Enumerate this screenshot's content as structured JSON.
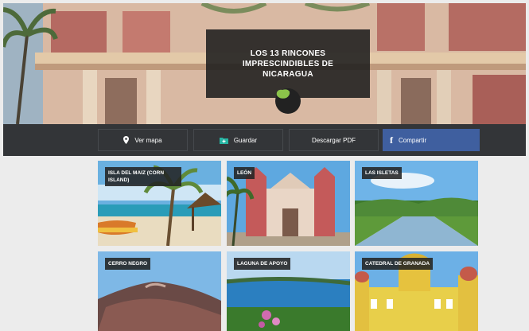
{
  "hero": {
    "title": "LOS 13 RINCONES IMPRESCINDIBLES DE NICARAGUA",
    "badge_icon": "nicaragua-map-icon",
    "accent": "#8bc34a"
  },
  "actions": {
    "map_label": "Ver mapa",
    "map_icon": "location-pin-icon",
    "save_label": "Guardar",
    "save_icon": "folder-plus-icon",
    "pdf_label": "Descargar PDF",
    "share_label": "Compartir",
    "share_icon": "facebook-icon",
    "share_color": "#3f5f9f"
  },
  "places": [
    {
      "label": "ISLA DEL MAIZ (CORN ISLAND)"
    },
    {
      "label": "LEÓN"
    },
    {
      "label": "LAS ISLETAS"
    },
    {
      "label": "CERRO NEGRO"
    },
    {
      "label": "LAGUNA DE APOYO"
    },
    {
      "label": "CATEDRAL DE GRANADA"
    }
  ]
}
